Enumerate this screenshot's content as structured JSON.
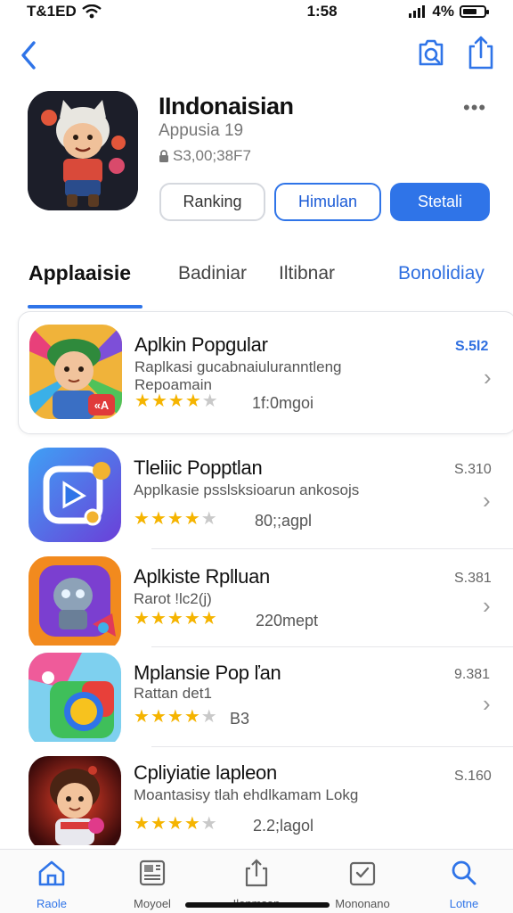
{
  "status_bar": {
    "carrier": "T&1ED",
    "time": "1:58",
    "battery": "4%",
    "battery_level": 0.7
  },
  "nav": {
    "back_icon": "chevron-left-icon",
    "search_icon": "search-icon",
    "share_icon": "share-icon"
  },
  "app": {
    "title": "IIndonaisian",
    "subtitle": "Appusia 19",
    "meta": "S3,00;38F7",
    "more": "•••"
  },
  "actions": {
    "ranking": "Ranking",
    "outline": "Himulan",
    "filled": "Stetali"
  },
  "tabs": [
    "Applaaisie",
    "Badiniar",
    "Iltibnar",
    "Bonolidiay"
  ],
  "colors": {
    "accent": "#2f74e8",
    "star": "#f5b400"
  },
  "list": [
    {
      "title": "Aplkin Popgular",
      "desc": "Raplkasi gucabnaiuluranntleng",
      "desc2": "Repoamain",
      "price": "S.5l2",
      "rating": 4,
      "count": "1f:0mgoi"
    },
    {
      "title": "Tleliic Popptlan",
      "desc": "Applkasie psslsksioarun ankosojs",
      "desc2": "",
      "price": "S.310",
      "rating": 3.5,
      "count": "80;;agpl"
    },
    {
      "title": "Aplkiste Rplluan",
      "desc": "Rarot !lc2(j)",
      "desc2": "",
      "price": "S.381",
      "rating": 4.5,
      "count": "220mept"
    },
    {
      "title": "Mplansie Pop ľan",
      "desc": "Rattan det1",
      "desc2": "",
      "price": "9.381",
      "rating": 3.5,
      "count": "B3"
    },
    {
      "title": "Cpliyiatie lapleon",
      "desc": "Moantasisy tlah ehdlkamam Lokg",
      "desc2": "",
      "price": "S.160",
      "rating": 4,
      "count": "2.2;lagol"
    }
  ],
  "tabbar": [
    {
      "label": "Raole",
      "icon": "home-icon"
    },
    {
      "label": "Moyoel",
      "icon": "news-icon"
    },
    {
      "label": "Ilonmsan",
      "icon": "share-icon"
    },
    {
      "label": "Mononano",
      "icon": "inbox-check-icon"
    },
    {
      "label": "Lotne",
      "icon": "search-icon"
    }
  ]
}
